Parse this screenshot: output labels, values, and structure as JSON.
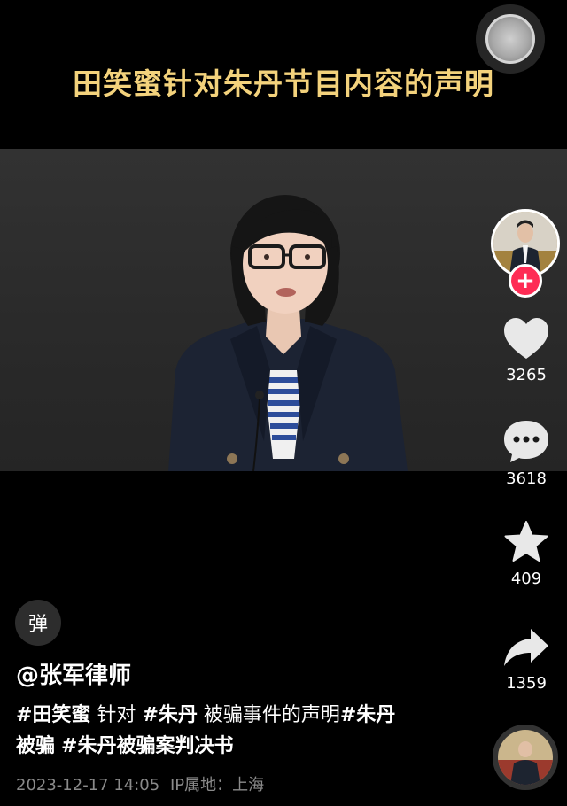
{
  "overlay_title": "田笑蜜针对朱丹节目内容的声明",
  "sidebar": {
    "like_count": "3265",
    "comment_count": "3618",
    "favorite_count": "409",
    "share_count": "1359"
  },
  "danmaku_label": "弹",
  "author": "@张军律师",
  "description": {
    "line1": [
      "#田笑蜜",
      " 针对 ",
      "#朱丹",
      " 被骗事件的声明",
      "#朱丹"
    ],
    "line2": [
      "被骗",
      " ",
      "#朱丹被骗案判决书"
    ]
  },
  "meta": {
    "datetime": "2023-12-17 14:05",
    "ip_label": "IP属地：上海"
  },
  "icons": {
    "floating": "floating-assistant-icon",
    "follow": "plus-icon",
    "like": "heart-icon",
    "comment": "comment-bubble-icon",
    "favorite": "star-icon",
    "share": "share-arrow-icon",
    "music": "music-disc-icon"
  },
  "colors": {
    "title": "#f3d27c",
    "follow": "#fe2c55",
    "meta": "#8a8a8a"
  }
}
